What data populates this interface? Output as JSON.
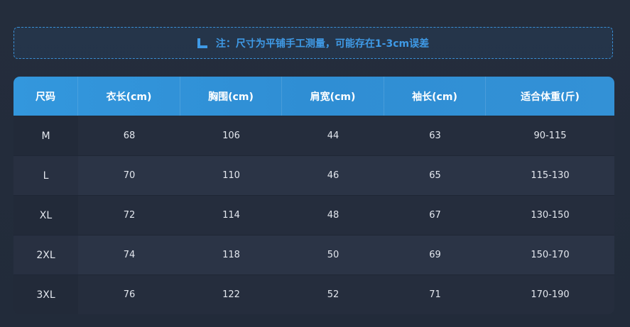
{
  "note": {
    "icon": "ruler-icon",
    "text": "注：尺寸为平铺手工测量，可能存在1-3cm误差"
  },
  "table": {
    "headers": [
      "尺码",
      "衣长(cm)",
      "胸围(cm)",
      "肩宽(cm)",
      "袖长(cm)",
      "适合体重(斤)"
    ],
    "rows": [
      [
        "M",
        "68",
        "106",
        "44",
        "63",
        "90-115"
      ],
      [
        "L",
        "70",
        "110",
        "46",
        "65",
        "115-130"
      ],
      [
        "XL",
        "72",
        "114",
        "48",
        "67",
        "130-150"
      ],
      [
        "2XL",
        "74",
        "118",
        "50",
        "69",
        "150-170"
      ],
      [
        "3XL",
        "76",
        "122",
        "52",
        "71",
        "170-190"
      ]
    ]
  },
  "colors": {
    "accent": "#3397dd",
    "background": "#232c3b",
    "note_text": "#3f9ae6"
  }
}
